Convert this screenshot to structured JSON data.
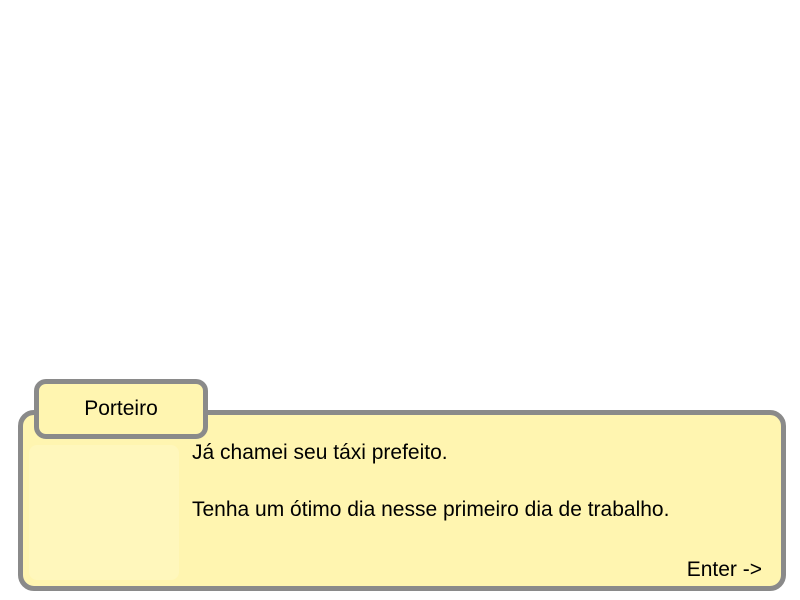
{
  "dialog": {
    "speaker": "Porteiro",
    "lines": [
      "Já chamei seu táxi prefeito.",
      "Tenha um ótimo dia nesse primeiro dia de trabalho."
    ],
    "continue_prompt": "Enter ->"
  },
  "colors": {
    "box_fill": "#fff5b0",
    "box_border": "#8a8a8a",
    "background": "#ffffff",
    "text": "#000000"
  }
}
